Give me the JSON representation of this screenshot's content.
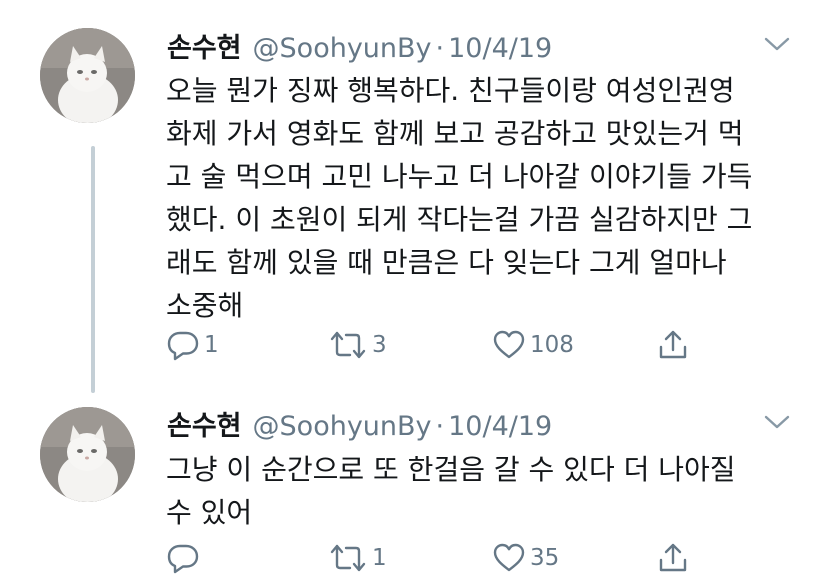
{
  "tweets": [
    {
      "name": "손수현",
      "handle": "@SoohyunBy",
      "separator": "·",
      "date": "10/4/19",
      "text": "오늘 뭔가 징짜 행복하다. 친구들이랑 여성인권영\n화제 가서 영화도 함께 보고 공감하고 맛있는거 먹\n고 술 먹으며 고민 나누고 더 나아갈 이야기들 가득\n했다. 이 초원이 되게 작다는걸 가끔 실감하지만 그\n래도 함께 있을 때 만큼은 다 잊는다 그게 얼마나\n소중해",
      "replies": "1",
      "retweets": "3",
      "likes": "108"
    },
    {
      "name": "손수현",
      "handle": "@SoohyunBy",
      "separator": "·",
      "date": "10/4/19",
      "text": "그냥 이 순간으로 또 한걸음 갈 수 있다 더 나아질\n수 있어",
      "replies": "",
      "retweets": "1",
      "likes": "35"
    }
  ],
  "icons": {
    "reply": "reply-icon",
    "retweet": "retweet-icon",
    "like": "heart-icon",
    "share": "share-icon",
    "more": "chevron-down-icon"
  },
  "colors": {
    "text": "#14171a",
    "secondary": "#657786",
    "thread_line": "#c4cfd6"
  }
}
